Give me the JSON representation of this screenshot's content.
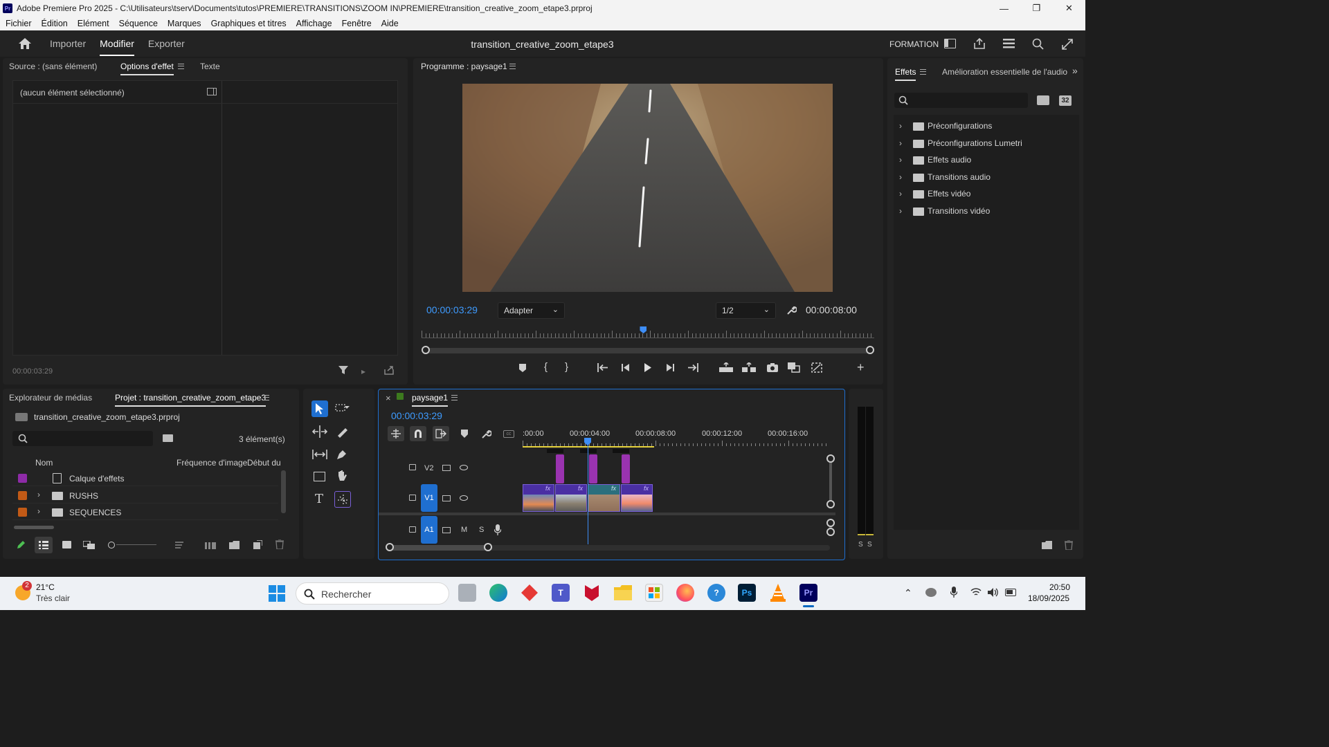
{
  "titlebar": {
    "title": "Adobe Premiere Pro 2025 - C:\\Utilisateurs\\tserv\\Documents\\tutos\\PREMIERE\\TRANSITIONS\\ZOOM IN\\PREMIERE\\transition_creative_zoom_etape3.prproj",
    "logo": "Pr",
    "minimize": "—",
    "maximize": "❐",
    "close": "✕"
  },
  "menu": [
    "Fichier",
    "Édition",
    "Elément",
    "Séquence",
    "Marques",
    "Graphiques et titres",
    "Affichage",
    "Fenêtre",
    "Aide"
  ],
  "header": {
    "tabs": [
      "Importer",
      "Modifier",
      "Exporter"
    ],
    "active_tab": "Modifier",
    "project_title": "transition_creative_zoom_etape3",
    "workspace": "FORMATION"
  },
  "effect_options_panel": {
    "tabs": [
      "Source : (sans élément)",
      "Options d'effet",
      "Texte"
    ],
    "active_tab": "Options d'effet",
    "empty_message": "(aucun élément sélectionné)",
    "timecode": "00:00:03:29"
  },
  "program_monitor": {
    "title": "Programme : paysage1",
    "timecode": "00:00:03:29",
    "fit": "Adapter",
    "resolution": "1/2",
    "duration": "00:00:08:00",
    "playhead_fraction": 0.49
  },
  "effects_panel": {
    "tabs": [
      "Effets",
      "Amélioration essentielle de l'audio"
    ],
    "active_tab": "Effets",
    "badge": "32",
    "items": [
      {
        "label": "Préconfigurations",
        "icon": "preset-folder-icon"
      },
      {
        "label": "Préconfigurations Lumetri",
        "icon": "preset-folder-icon"
      },
      {
        "label": "Effets audio",
        "icon": "folder-icon"
      },
      {
        "label": "Transitions audio",
        "icon": "folder-icon"
      },
      {
        "label": "Effets vidéo",
        "icon": "folder-icon"
      },
      {
        "label": "Transitions vidéo",
        "icon": "folder-icon"
      }
    ]
  },
  "project_panel": {
    "tabs": [
      "Explorateur de médias",
      "Projet : transition_creative_zoom_etape3"
    ],
    "active_tab": "Projet : transition_creative_zoom_etape3",
    "file_name": "transition_creative_zoom_etape3.prproj",
    "item_count": "3 élément(s)",
    "columns": [
      "Nom",
      "Fréquence d'image",
      "Début du"
    ],
    "rows": [
      {
        "name": "Calque d'effets",
        "color": "#8e2ba7",
        "type": "effect-layer"
      },
      {
        "name": "RUSHS",
        "color": "#c25a16",
        "type": "bin"
      },
      {
        "name": "SEQUENCES",
        "color": "#c25a16",
        "type": "bin"
      }
    ]
  },
  "timeline": {
    "sequence_name": "paysage1",
    "close": "×",
    "timecode": "00:00:03:29",
    "ruler_labels": [
      ":00:00",
      "00:00:04:00",
      "00:00:08:00",
      "00:00:12:00",
      "00:00:16:00"
    ],
    "tracks": {
      "v2": "V2",
      "v1": "V1",
      "a1": "A1",
      "mute": "M",
      "solo": "S"
    },
    "fx_label": "fx"
  },
  "audio_meter": {
    "labels": [
      "S",
      "S"
    ]
  },
  "taskbar": {
    "weather_temp": "21°C",
    "weather_desc": "Très clair",
    "weather_badge": "2",
    "search_placeholder": "Rechercher",
    "time": "20:50",
    "date": "18/09/2025",
    "ps_label": "Ps",
    "pr_label": "Pr"
  }
}
